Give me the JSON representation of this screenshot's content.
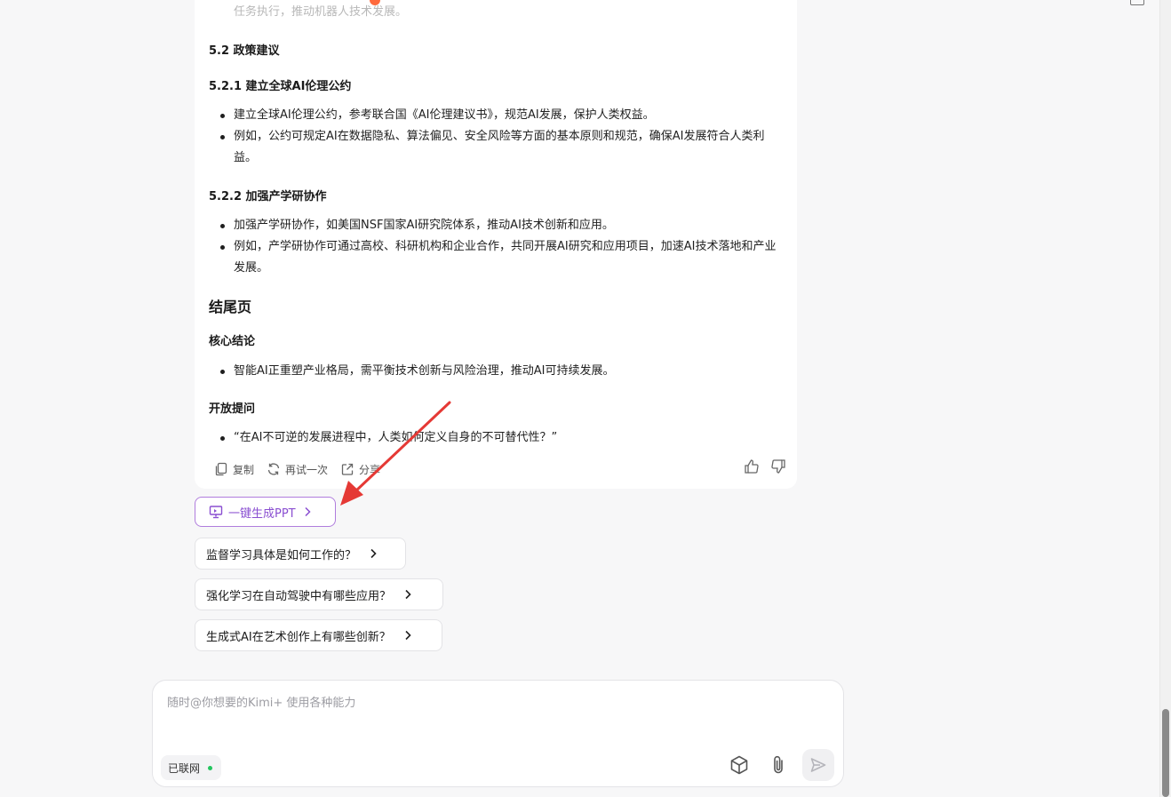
{
  "header": {
    "title_cut": "…"
  },
  "answer": {
    "cut_text": "任务执行，推动机器人技术发展。",
    "section_52": "5.2 政策建议",
    "section_521": "5.2.1 建立全球AI伦理公约",
    "bullets_521": [
      "建立全球AI伦理公约，参考联合国《AI伦理建议书》，规范AI发展，保护人类权益。",
      "例如，公约可规定AI在数据隐私、算法偏见、安全风险等方面的基本原则和规范，确保AI发展符合人类利益。"
    ],
    "section_522": "5.2.2 加强产学研协作",
    "bullets_522": [
      "加强产学研协作，如美国NSF国家AI研究院体系，推动AI技术创新和应用。",
      "例如，产学研协作可通过高校、科研机构和企业合作，共同开展AI研究和应用项目，加速AI技术落地和产业发展。"
    ],
    "ending_title": "结尾页",
    "core_title": "核心结论",
    "core_bullets": [
      "智能AI正重塑产业格局，需平衡技术创新与风险治理，推动AI可持续发展。"
    ],
    "open_title": "开放提问",
    "open_bullets": [
      "“在AI不可逆的发展进程中，人类如何定义自身的不可替代性？”"
    ],
    "actions": {
      "copy": "复制",
      "retry": "再试一次",
      "share": "分享"
    }
  },
  "ppt_button": "一键生成PPT",
  "suggestions": [
    "监督学习具体是如何工作的？",
    "强化学习在自动驾驶中有哪些应用？",
    "生成式AI在艺术创作上有哪些创新？"
  ],
  "composer": {
    "placeholder": "随时@你想要的Kimi+ 使用各种能力",
    "network_label": "已联网"
  },
  "colors": {
    "accent": "#8a4fd1",
    "arrow": "#e53935",
    "online": "#22c55e"
  }
}
